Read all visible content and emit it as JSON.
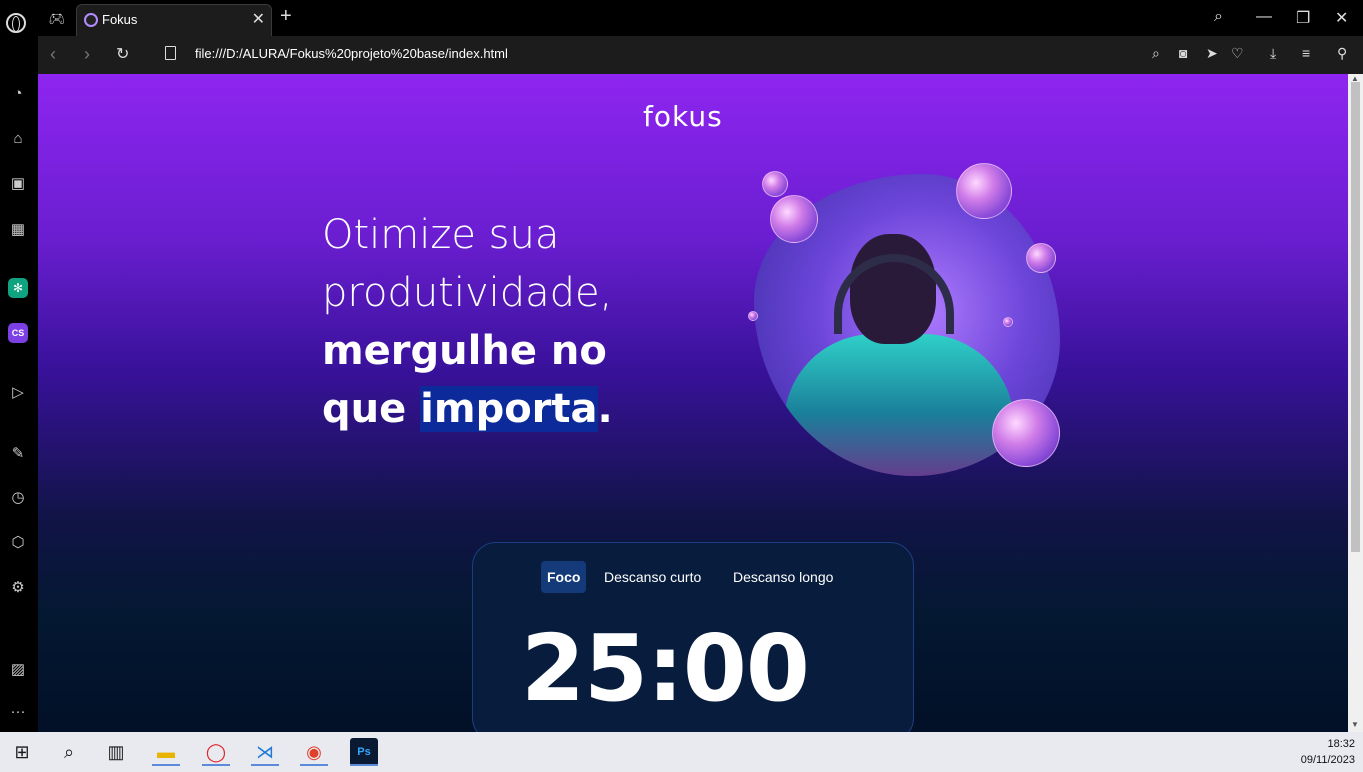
{
  "browser": {
    "tab_title": "Fokus",
    "url": "file:///D:/ALURA/Fokus%20projeto%20base/index.html",
    "new_tab": "+",
    "close_tab": "✕"
  },
  "page": {
    "logo": "fokus",
    "headline_line1": "Otimize sua",
    "headline_line2": "produtividade,",
    "headline_line3": "mergulhe no",
    "headline_line4_a": "que ",
    "headline_line4_mark": "importa",
    "headline_line4_b": ".",
    "tabs": [
      {
        "label": "Foco",
        "active": true
      },
      {
        "label": "Descanso curto",
        "active": false
      },
      {
        "label": "Descanso longo",
        "active": false
      }
    ],
    "timer": "25:00"
  },
  "taskbar": {
    "time": "18:32",
    "date": "09/11/2023"
  },
  "colors": {
    "accent": "#8e25f0",
    "card_bg": "#081d3e",
    "active_tab": "#143a7a",
    "highlight": "#0d2a9a"
  }
}
